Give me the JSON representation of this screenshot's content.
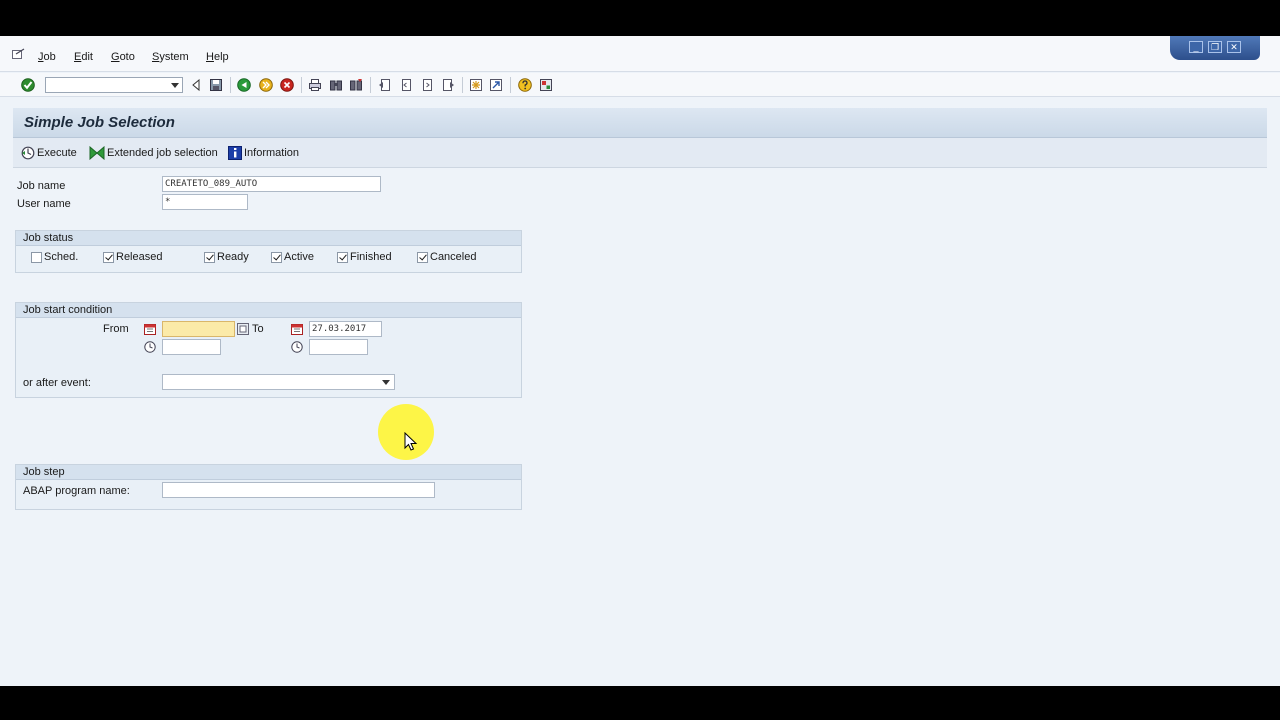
{
  "menu": {
    "items": [
      {
        "label": "Job"
      },
      {
        "label": "Edit"
      },
      {
        "label": "Goto"
      },
      {
        "label": "System"
      },
      {
        "label": "Help"
      }
    ]
  },
  "window_controls": {
    "minimize": "_",
    "restore": "❐",
    "close": "✕"
  },
  "toolbar": {
    "command_field_value": "",
    "icons": [
      "enter-icon",
      "back-icon",
      "save-icon",
      "green-back-icon",
      "exit-icon",
      "cancel-icon",
      "print-icon",
      "find-icon",
      "find-next-icon",
      "first-page-icon",
      "previous-page-icon",
      "next-page-icon",
      "last-page-icon",
      "create-session-icon",
      "shortcut-icon",
      "help-icon",
      "layout-icon"
    ]
  },
  "title": "Simple Job Selection",
  "app_toolbar": {
    "execute": "Execute",
    "extended": "Extended job selection",
    "information": "Information"
  },
  "fields": {
    "job_name_label": "Job name",
    "job_name_value": "CREATETO_089_AUTO",
    "user_name_label": "User name",
    "user_name_value": "*"
  },
  "job_status": {
    "title": "Job status",
    "options": [
      {
        "label": "Sched.",
        "checked": false
      },
      {
        "label": "Released",
        "checked": true
      },
      {
        "label": "Ready",
        "checked": true
      },
      {
        "label": "Active",
        "checked": true
      },
      {
        "label": "Finished",
        "checked": true
      },
      {
        "label": "Canceled",
        "checked": true
      }
    ]
  },
  "job_start": {
    "title": "Job start condition",
    "from_label": "From",
    "to_label": "To",
    "from_date": "",
    "from_time": "",
    "to_date": "27.03.2017",
    "to_time": "",
    "event_label": "or after event:",
    "event_value": ""
  },
  "job_step": {
    "title": "Job step",
    "program_label": "ABAP program name:",
    "program_value": ""
  },
  "colors": {
    "background": "#eef3f9",
    "title_bar": "#cbd9e8",
    "required_field": "#fbeaa8",
    "cursor_highlight": "#fff428"
  }
}
